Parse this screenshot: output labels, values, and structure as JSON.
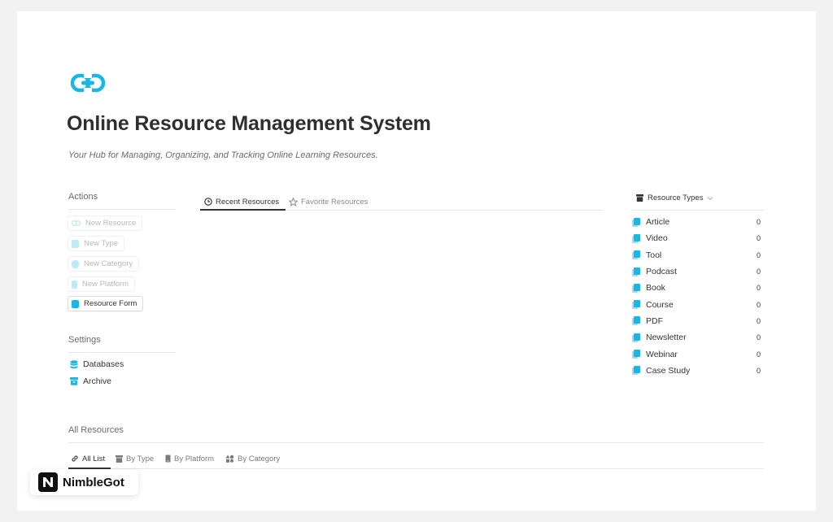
{
  "colors": {
    "accent": "#1ab7e6",
    "accent_light": "#bfe9f5",
    "text": "#37352f",
    "muted": "#8a8a8a"
  },
  "header": {
    "logo_icon": "link-icon",
    "title": "Online Resource Management System",
    "subtitle": "Your Hub for Managing, Organizing, and Tracking Online Learning Resources."
  },
  "actions": {
    "heading": "Actions",
    "buttons": [
      {
        "label": "New Resource",
        "icon": "link-icon"
      },
      {
        "label": "New Type",
        "icon": "file-icon"
      },
      {
        "label": "New Category",
        "icon": "layers-icon"
      },
      {
        "label": "New Platform",
        "icon": "device-icon"
      },
      {
        "label": "Resource Form",
        "icon": "form-icon"
      }
    ]
  },
  "settings": {
    "heading": "Settings",
    "items": [
      {
        "label": "Databases",
        "icon": "database-icon"
      },
      {
        "label": "Archive",
        "icon": "archive-icon"
      }
    ]
  },
  "main_tabs": [
    {
      "label": "Recent Resources",
      "icon": "clock-icon",
      "active": true
    },
    {
      "label": "Favorite Resources",
      "icon": "star-icon",
      "active": false
    }
  ],
  "resource_types": {
    "heading": "Resource Types",
    "items": [
      {
        "name": "Article",
        "count": "0"
      },
      {
        "name": "Video",
        "count": "0"
      },
      {
        "name": "Tool",
        "count": "0"
      },
      {
        "name": "Podcast",
        "count": "0"
      },
      {
        "name": "Book",
        "count": "0"
      },
      {
        "name": "Course",
        "count": "0"
      },
      {
        "name": "PDF",
        "count": "0"
      },
      {
        "name": "Newsletter",
        "count": "0"
      },
      {
        "name": "Webinar",
        "count": "0"
      },
      {
        "name": "Case Study",
        "count": "0"
      }
    ]
  },
  "all_resources": {
    "heading": "All Resources",
    "tabs": [
      {
        "label": "All List",
        "icon": "link-icon",
        "active": true
      },
      {
        "label": "By Type",
        "icon": "archive-icon",
        "active": false
      },
      {
        "label": "By Platform",
        "icon": "device-icon",
        "active": false
      },
      {
        "label": "By Category",
        "icon": "shapes-icon",
        "active": false
      }
    ]
  },
  "badge": {
    "text": "NimbleGot",
    "icon": "nimblegot-logo"
  }
}
